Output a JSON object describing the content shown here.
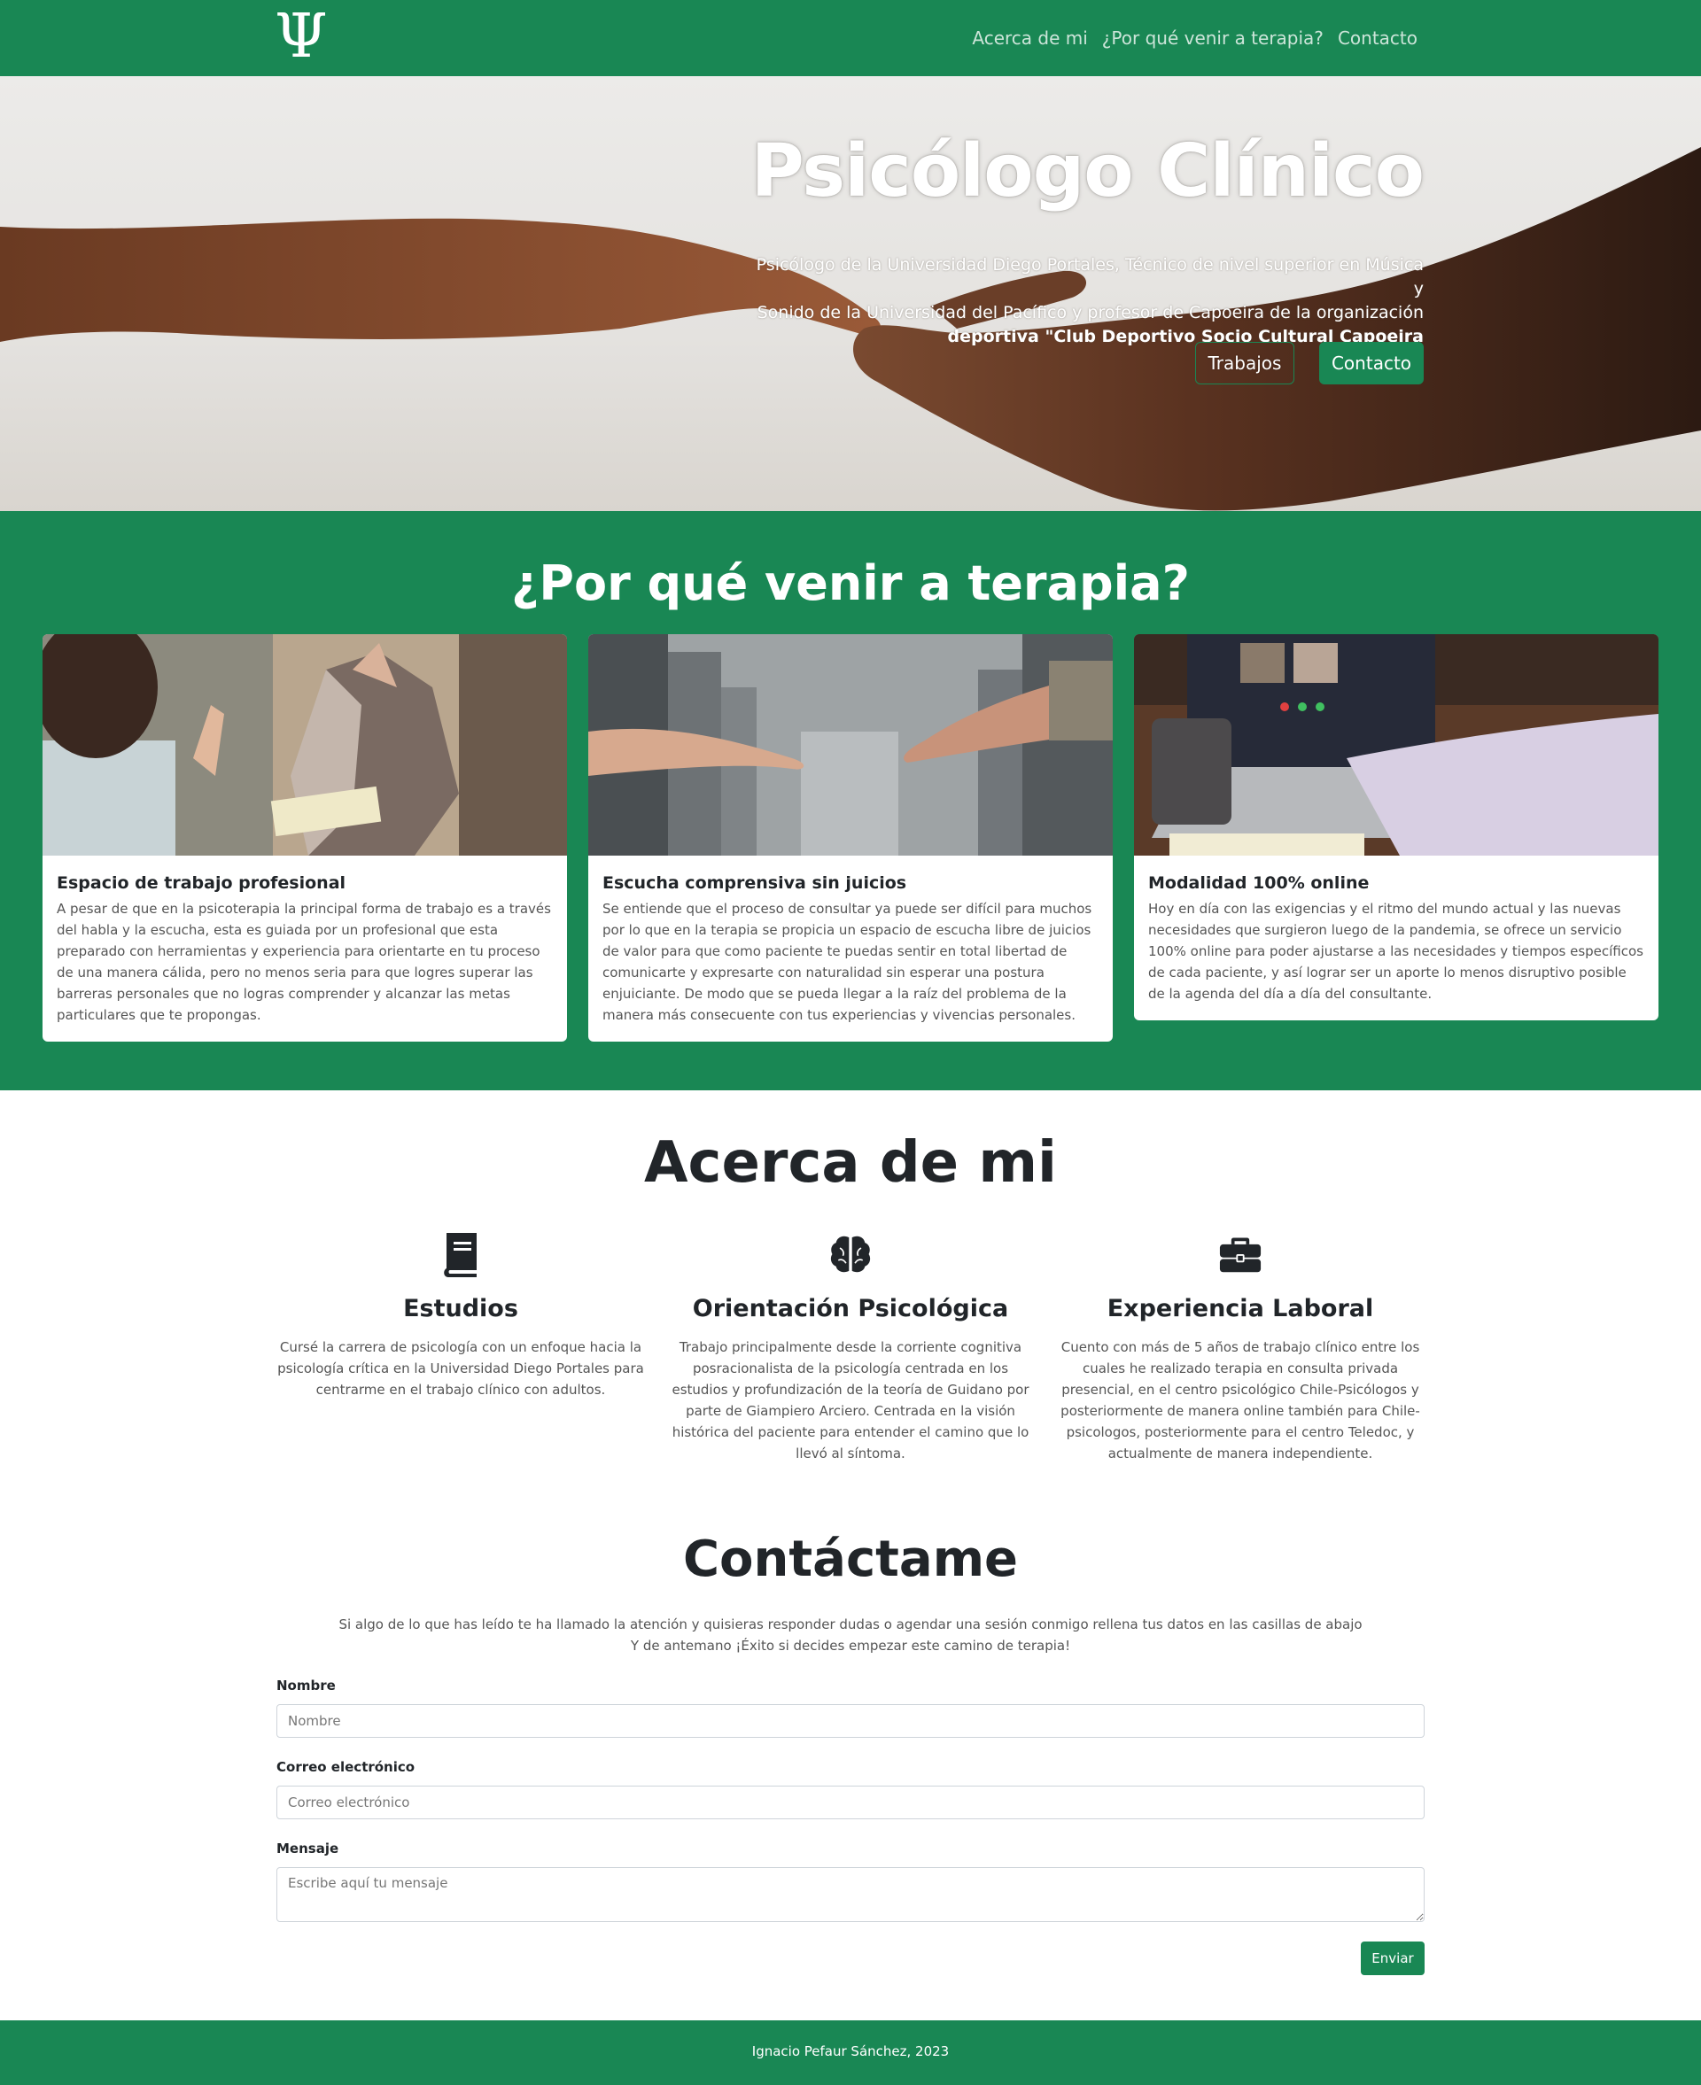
{
  "colors": {
    "brand_green": "#198754",
    "text_dark": "#212529"
  },
  "navbar": {
    "logo_glyph": "Ψ",
    "links": [
      "Acerca de mi",
      "¿Por qué venir a terapia?",
      "Contacto"
    ]
  },
  "hero": {
    "title": "Psicólogo Clínico",
    "text_line1": "Psicólogo de la Universidad Diego Portales, Técnico de nivel superior en Música y",
    "text_line2": "Sonido de la Universidad del Pacífico y profesor de Capoeira de la organización",
    "text_line3": "deportiva \"Club Deportivo Socio Cultural Capoeira",
    "btn_works": "Trabajos",
    "btn_contact": "Contacto"
  },
  "why": {
    "title": "¿Por qué venir a terapia?",
    "cards": [
      {
        "title": "Espacio de trabajo profesional",
        "text": "A pesar de que en la psicoterapia la principal forma de trabajo es a través del habla y la escucha, esta es guiada por un profesional que esta preparado con herramientas y experiencia para orientarte en tu proceso de una manera cálida, pero no menos seria para que logres superar las barreras personales que no logras comprender y alcanzar las metas particulares que te propongas."
      },
      {
        "title": "Escucha comprensiva sin juicios",
        "text": "Se entiende que el proceso de consultar ya puede ser difícil para muchos por lo que en la terapia se propicia un espacio de escucha libre de juicios de valor para que como paciente te puedas sentir en total libertad de comunicarte y expresarte con naturalidad sin esperar una postura enjuiciante. De modo que se pueda llegar a la raíz del problema de la manera más consecuente con tus experiencias y vivencias personales."
      },
      {
        "title": "Modalidad 100% online",
        "text": "Hoy en día con las exigencias y el ritmo del mundo actual y las nuevas necesidades que surgieron luego de la pandemia, se ofrece un servicio 100% online para poder ajustarse a las necesidades y tiempos específicos de cada paciente, y así lograr ser un aporte lo menos disruptivo posible de la agenda del día a día del consultante."
      }
    ]
  },
  "about": {
    "title": "Acerca de mi",
    "features": [
      {
        "icon": "book-icon",
        "title": "Estudios",
        "text": "Cursé la carrera de psicología con un enfoque hacia la psicología crítica en la Universidad Diego Portales para centrarme en el trabajo clínico con adultos."
      },
      {
        "icon": "brain-icon",
        "title": "Orientación Psicológica",
        "text": "Trabajo principalmente desde la corriente cognitiva posracionalista de la psicología centrada en los estudios y profundización de la teoría de Guidano por parte de Giampiero Arciero. Centrada en la visión histórica del paciente para entender el camino que lo llevó al síntoma."
      },
      {
        "icon": "briefcase-icon",
        "title": "Experiencia Laboral",
        "text": "Cuento con más de 5 años de trabajo clínico entre los cuales he realizado terapia en consulta privada presencial, en el centro psicológico Chile-Psicólogos y posteriormente de manera online también para Chile-psicologos, posteriormente para el centro Teledoc, y actualmente de manera independiente."
      }
    ]
  },
  "contact": {
    "title": "Contáctame",
    "intro_line1": "Si algo de lo que has leído te ha llamado la atención y quisieras responder dudas o agendar una sesión conmigo rellena tus datos en las casillas de abajo",
    "intro_line2": "Y de antemano ¡Éxito si decides empezar este camino de terapia!",
    "name_label": "Nombre",
    "name_placeholder": "Nombre",
    "email_label": "Correo electrónico",
    "email_placeholder": "Correo electrónico",
    "message_label": "Mensaje",
    "message_placeholder": "Escribe aquí tu mensaje",
    "submit": "Enviar"
  },
  "footer": {
    "text": "Ignacio Pefaur Sánchez, 2023"
  }
}
